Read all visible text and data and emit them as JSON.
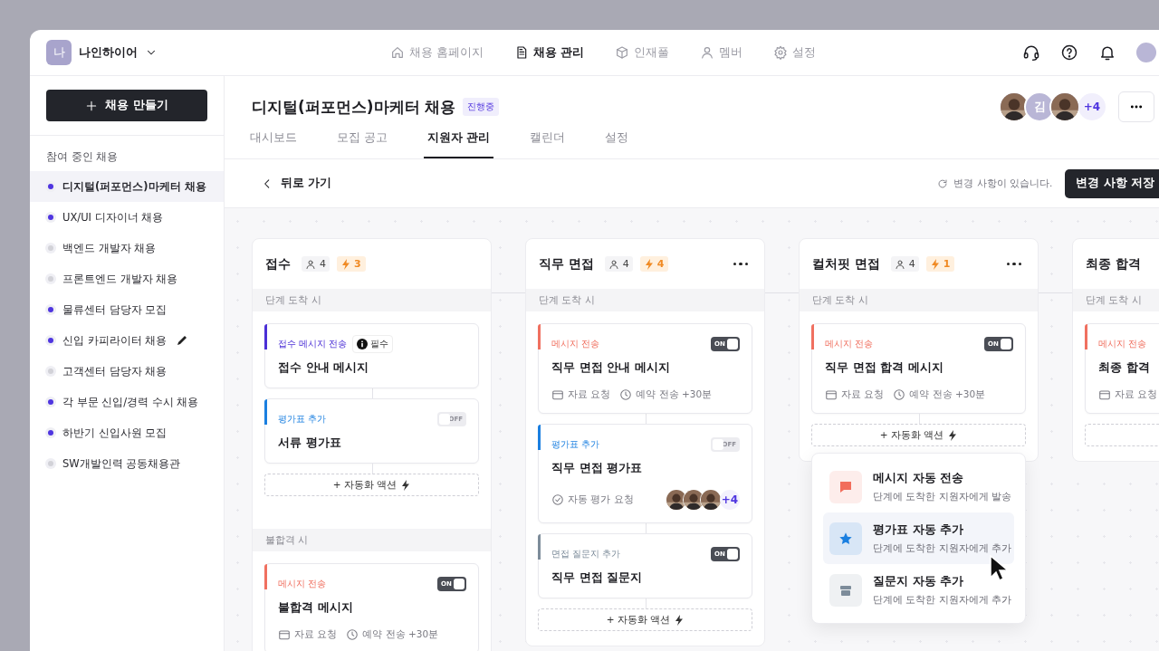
{
  "brand": {
    "initial": "나",
    "name": "나인하이어"
  },
  "nav": [
    {
      "label": "채용 홈페이지",
      "kind": "home",
      "selected": false
    },
    {
      "label": "채용 관리",
      "kind": "document",
      "selected": true
    },
    {
      "label": "인재풀",
      "kind": "cube",
      "selected": false
    },
    {
      "label": "멤버",
      "kind": "person",
      "selected": false
    },
    {
      "label": "설정",
      "kind": "gear",
      "selected": false
    }
  ],
  "create_button": "채용 만들기",
  "sidebar": {
    "heading": "참여 중인 채용",
    "items": [
      {
        "label": "디지털(퍼포먼스)마케터 채용",
        "color": "#4f35e0",
        "selected": true,
        "editing": false
      },
      {
        "label": "UX/UI 디자이너 채용",
        "color": "#4f35e0",
        "selected": false,
        "editing": false
      },
      {
        "label": "백엔드 개발자 채용",
        "color": "#d2d2d8",
        "selected": false,
        "editing": false
      },
      {
        "label": "프론트엔드 개발자 채용",
        "color": "#d2d2d8",
        "selected": false,
        "editing": false
      },
      {
        "label": "물류센터 담당자 모집",
        "color": "#4f35e0",
        "selected": false,
        "editing": false
      },
      {
        "label": "신입 카피라이터 채용",
        "color": "#4f35e0",
        "selected": false,
        "editing": true
      },
      {
        "label": "고객센터 담당자 채용",
        "color": "#d2d2d8",
        "selected": false,
        "editing": false
      },
      {
        "label": "각 부문 신입/경력 수시 채용",
        "color": "#4f35e0",
        "selected": false,
        "editing": false
      },
      {
        "label": "하반기 신입사원 모집",
        "color": "#4f35e0",
        "selected": false,
        "editing": false
      },
      {
        "label": "SW개발인력 공동채용관",
        "color": "#d2d2d8",
        "selected": false,
        "editing": false
      }
    ]
  },
  "header": {
    "title": "디지털(퍼포먼스)마케터 채용",
    "status": "진행중",
    "avatars": [
      {
        "kind": "picture"
      },
      {
        "kind": "initial",
        "text": "김"
      },
      {
        "kind": "picture"
      }
    ],
    "more_members": "+4"
  },
  "tabs": [
    {
      "label": "대시보드",
      "selected": false
    },
    {
      "label": "모집 공고",
      "selected": false
    },
    {
      "label": "지원자 관리",
      "selected": true
    },
    {
      "label": "캘린더",
      "selected": false
    },
    {
      "label": "설정",
      "selected": false
    }
  ],
  "toolbar": {
    "back": "뒤로 가기",
    "notice": "변경 사항이 있습니다.",
    "save": "변경 사항 저장"
  },
  "columns": [
    {
      "title": "접수",
      "applicants": "4",
      "automations": "3",
      "more": false,
      "add_action": "+ 자동화 액션",
      "sections": [
        {
          "label": "단계 도착 시",
          "cards": [
            {
              "label": "접수 메시지 전송",
              "color": "#4b2fd6",
              "badge": "필수",
              "title": "접수 안내 메시지"
            },
            {
              "label": "평가표 추가",
              "color": "#1a7fe0",
              "toggle": {
                "on": false,
                "label": "OFF"
              },
              "title": "서류 평가표"
            }
          ]
        },
        {
          "label": "불합격 시",
          "cards": [
            {
              "label": "메시지 전송",
              "color": "#f07060",
              "toggle": {
                "on": true,
                "label": "ON"
              },
              "title": "불합격 메시지",
              "meta": [
                {
                  "kind": "calendar",
                  "text": "자료 요청"
                },
                {
                  "kind": "clock",
                  "text": "예약 전송 +30분"
                }
              ]
            }
          ]
        }
      ]
    },
    {
      "title": "직무 면접",
      "applicants": "4",
      "automations": "4",
      "more": true,
      "add_action": "+ 자동화 액션",
      "sections": [
        {
          "label": "단계 도착 시",
          "cards": [
            {
              "label": "메시지 전송",
              "color": "#f07060",
              "toggle": {
                "on": true,
                "label": "ON"
              },
              "title": "직무 면접 안내 메시지",
              "meta": [
                {
                  "kind": "calendar",
                  "text": "자료 요청"
                },
                {
                  "kind": "clock",
                  "text": "예약 전송 +30분"
                }
              ]
            },
            {
              "label": "평가표 추가",
              "color": "#1a7fe0",
              "toggle": {
                "on": false,
                "label": "OFF"
              },
              "title": "직무 면접 평가표",
              "meta": [
                {
                  "kind": "check",
                  "text": "자동 평가 요청"
                }
              ],
              "reviewers": {
                "avatars": [
                  {
                    "kind": "picture"
                  },
                  {
                    "kind": "picture"
                  },
                  {
                    "kind": "picture"
                  }
                ],
                "more": "+4"
              }
            },
            {
              "label": "면접 질문지 추가",
              "color": "#7d8c9a",
              "toggle": {
                "on": true,
                "label": "ON"
              },
              "title": "직무 면접 질문지"
            }
          ]
        }
      ]
    },
    {
      "title": "컬처핏 면접",
      "applicants": "4",
      "automations": "1",
      "more": true,
      "add_action": "+ 자동화 액션",
      "sections": [
        {
          "label": "단계 도착 시",
          "cards": [
            {
              "label": "메시지 전송",
              "color": "#f07060",
              "toggle": {
                "on": true,
                "label": "ON"
              },
              "title": "직무 면접 합격 메시지",
              "meta": [
                {
                  "kind": "calendar",
                  "text": "자료 요청"
                },
                {
                  "kind": "clock",
                  "text": "예약 전송 +30분"
                }
              ]
            }
          ]
        }
      ],
      "action_menu": [
        {
          "kind": "message",
          "color": "#f26d5b",
          "title": "메시지 자동 전송",
          "description": "단계에 도착한 지원자에게 발송",
          "selected": false
        },
        {
          "kind": "star",
          "color": "#1a7fe0",
          "title": "평가표 자동 추가",
          "description": "단계에 도착한 지원자에게 추가",
          "selected": true
        },
        {
          "kind": "box",
          "color": "#7d8c9a",
          "title": "질문지 자동 추가",
          "description": "단계에 도착한 지원자에게 추가",
          "selected": false
        }
      ]
    },
    {
      "title": "최종 합격",
      "more": false,
      "sections": [
        {
          "label": "단계 도착 시",
          "cards": [
            {
              "label": "메시지 전송",
              "color": "#f07060",
              "title": "최종 합격",
              "meta": [
                {
                  "kind": "calendar",
                  "text": "자료 요청"
                }
              ]
            }
          ]
        }
      ]
    }
  ]
}
